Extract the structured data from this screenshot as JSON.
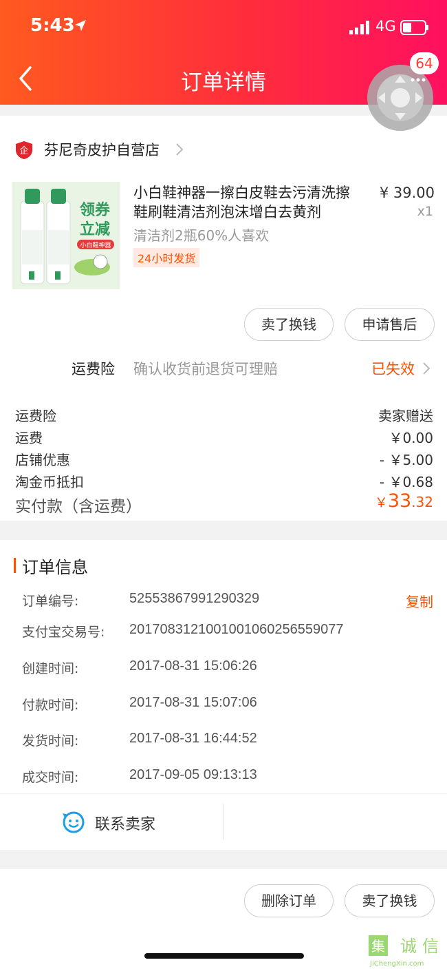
{
  "status_bar": {
    "time": "5:43",
    "network": "4G"
  },
  "nav": {
    "title": "订单详情",
    "float_badge": "64"
  },
  "shop": {
    "name": "芬尼奇皮护自营店",
    "icon": "enterprise-shield-icon",
    "icon_text": "企"
  },
  "product": {
    "title": "小白鞋神器一擦白皮鞋去污清洗擦鞋刷鞋清洁剂泡沫增白去黄剂",
    "price": "¥ 39.00",
    "qty": "x1",
    "sku": "清洁剂2瓶60%人喜欢",
    "tag": "24小时发货",
    "image_text": {
      "coupon_line1": "领券",
      "coupon_line2": "立减",
      "brand": "小白鞋神器"
    }
  },
  "item_actions": {
    "sell": "卖了换钱",
    "after_sale": "申请售后"
  },
  "insurance": {
    "label": "运费险",
    "desc": "确认收货前退货可理赔",
    "status": "已失效"
  },
  "fees": [
    {
      "label": "运费险",
      "value": "卖家赠送"
    },
    {
      "label": "运费",
      "value": "￥0.00"
    },
    {
      "label": "店铺优惠",
      "value": "- ￥5.00"
    },
    {
      "label": "淘金币抵扣",
      "value": "- ￥0.68"
    }
  ],
  "total": {
    "label": "实付款（含运费）",
    "symbol": "￥",
    "int": "33",
    "dec": ".32"
  },
  "order_info": {
    "title": "订单信息",
    "copy_label": "复制",
    "rows": [
      {
        "label": "订单编号:",
        "value": "52553867991290329"
      },
      {
        "label": "支付宝交易号:",
        "value": "2017083121001001060256559077"
      },
      {
        "label": "创建时间:",
        "value": "2017-08-31 15:06:26"
      },
      {
        "label": "付款时间:",
        "value": "2017-08-31 15:07:06"
      },
      {
        "label": "发货时间:",
        "value": "2017-08-31 16:44:52"
      },
      {
        "label": "成交时间:",
        "value": "2017-09-05 09:13:13"
      }
    ]
  },
  "contact": {
    "label": "联系卖家"
  },
  "bottom_actions": {
    "delete": "删除订单",
    "sell": "卖了换钱"
  },
  "watermark": {
    "cn": "集诚信",
    "en": "JiChengXin.com"
  },
  "colors": {
    "accent": "#ff5000",
    "header_start": "#ff5a1f",
    "header_end": "#ff1060"
  }
}
